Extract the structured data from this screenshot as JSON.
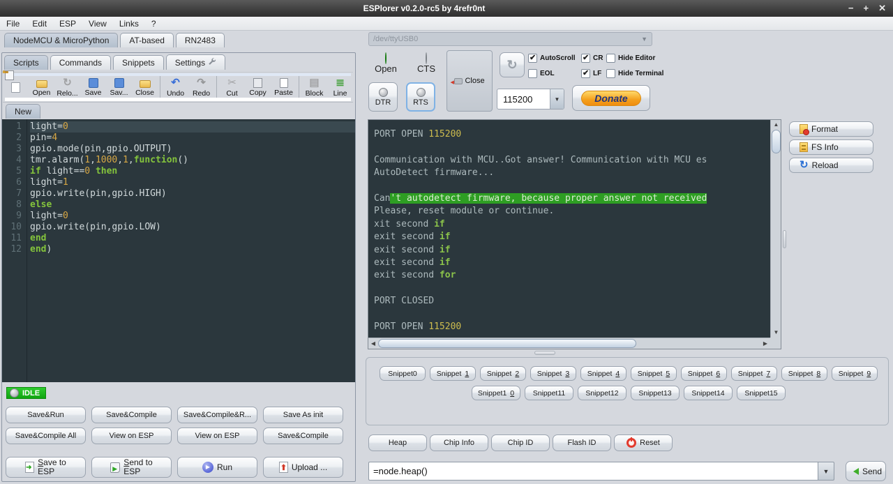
{
  "window": {
    "title": "ESPlorer v0.2.0-rc5 by 4refr0nt",
    "minimize": "−",
    "maximize": "+",
    "close": "✕"
  },
  "menu": {
    "items": [
      "File",
      "Edit",
      "ESP",
      "View",
      "Links",
      "?"
    ]
  },
  "left": {
    "device_tabs": [
      {
        "label": "NodeMCU & MicroPython",
        "selected": true
      },
      {
        "label": "AT-based",
        "selected": false
      },
      {
        "label": "RN2483",
        "selected": false
      }
    ],
    "tool_tabs": [
      {
        "label": "Scripts",
        "selected": true
      },
      {
        "label": "Commands",
        "selected": false
      },
      {
        "label": "Snippets",
        "selected": false
      },
      {
        "label": "Settings",
        "selected": false,
        "icon": "wrench-icon"
      }
    ],
    "toolbar": [
      {
        "label": "",
        "icon": "page",
        "name": "new-file",
        "gray": false
      },
      {
        "label": "Open",
        "icon": "folder",
        "name": "open",
        "gray": false
      },
      {
        "label": "Relo...",
        "icon": "reload-gray",
        "name": "reload",
        "gray": true
      },
      {
        "label": "Save",
        "icon": "floppy",
        "name": "save",
        "gray": false
      },
      {
        "label": "Sav...",
        "icon": "floppy",
        "name": "save-as",
        "gray": true
      },
      {
        "label": "Close",
        "icon": "folder",
        "name": "close-file",
        "gray": true
      },
      {
        "sep": true
      },
      {
        "label": "Undo",
        "icon": "undo",
        "name": "undo",
        "gray": false
      },
      {
        "label": "Redo",
        "icon": "redo",
        "name": "redo",
        "gray": true
      },
      {
        "sep": true
      },
      {
        "label": "Cut",
        "icon": "cut",
        "name": "cut",
        "gray": true
      },
      {
        "label": "Copy",
        "icon": "copy",
        "name": "copy",
        "gray": true
      },
      {
        "label": "Paste",
        "icon": "paste",
        "name": "paste",
        "gray": false
      },
      {
        "sep": true
      },
      {
        "label": "Block",
        "icon": "block",
        "name": "block-comment",
        "gray": true
      },
      {
        "label": "Line",
        "icon": "line",
        "name": "line-comment",
        "gray": false
      }
    ],
    "editor_tab": "New",
    "code_lines": [
      [
        {
          "t": "light=",
          "c": "p"
        },
        {
          "t": "0",
          "c": "n"
        }
      ],
      [
        {
          "t": "pin=",
          "c": "p"
        },
        {
          "t": "4",
          "c": "n"
        }
      ],
      [
        {
          "t": "gpio.mode(pin,gpio.OUTPUT)",
          "c": "p"
        }
      ],
      [
        {
          "t": "tmr.alarm(",
          "c": "p"
        },
        {
          "t": "1",
          "c": "n"
        },
        {
          "t": ",",
          "c": "p"
        },
        {
          "t": "1000",
          "c": "n"
        },
        {
          "t": ",",
          "c": "p"
        },
        {
          "t": "1",
          "c": "n"
        },
        {
          "t": ",",
          "c": "p"
        },
        {
          "t": "function",
          "c": "k"
        },
        {
          "t": "()",
          "c": "p"
        }
      ],
      [
        {
          "t": "if",
          "c": "k"
        },
        {
          "t": " light==",
          "c": "p"
        },
        {
          "t": "0",
          "c": "n"
        },
        {
          "t": " ",
          "c": "p"
        },
        {
          "t": "then",
          "c": "k"
        }
      ],
      [
        {
          "t": "light=",
          "c": "p"
        },
        {
          "t": "1",
          "c": "n"
        }
      ],
      [
        {
          "t": "gpio.write(pin,gpio.HIGH)",
          "c": "p"
        }
      ],
      [
        {
          "t": "else",
          "c": "k"
        }
      ],
      [
        {
          "t": "light=",
          "c": "p"
        },
        {
          "t": "0",
          "c": "n"
        }
      ],
      [
        {
          "t": "gpio.write(pin,gpio.LOW)",
          "c": "p"
        }
      ],
      [
        {
          "t": "end",
          "c": "k"
        }
      ],
      [
        {
          "t": "end",
          "c": "k"
        },
        {
          "t": ")",
          "c": "p"
        }
      ]
    ],
    "status": "IDLE",
    "action_row1": [
      "Save&Run",
      "Save&Compile",
      "Save&Compile&R...",
      "Save As init"
    ],
    "action_row2": [
      "Save&Compile All",
      "View on ESP",
      "View on ESP",
      "Save&Compile"
    ],
    "action_row3": [
      {
        "lines": [
          "Save to",
          "ESP"
        ],
        "icon": "savetoesp",
        "name": "save-to-esp",
        "underline_first": true
      },
      {
        "lines": [
          "Send to",
          "ESP"
        ],
        "icon": "sendtoesp",
        "name": "send-to-esp",
        "underline_first": true
      },
      {
        "lines": [
          "Run"
        ],
        "icon": "run",
        "name": "run",
        "underline_first": false
      },
      {
        "lines": [
          "Upload ..."
        ],
        "icon": "upload",
        "name": "upload",
        "underline_first": false
      }
    ]
  },
  "right": {
    "port": "/dev/ttyUSB0",
    "open_led_label": "Open",
    "cts_led_label": "CTS",
    "close_label": "Close",
    "checkbox_cols": [
      [
        {
          "label": "AutoScroll",
          "checked": true
        },
        {
          "label": "EOL",
          "checked": false
        }
      ],
      [
        {
          "label": "CR",
          "checked": true
        },
        {
          "label": "LF",
          "checked": true
        }
      ],
      [
        {
          "label": "Hide Editor",
          "checked": false
        },
        {
          "label": "Hide Terminal",
          "checked": false
        }
      ]
    ],
    "dtr_label": "DTR",
    "rts_label": "RTS",
    "baud": "115200",
    "donate_label": "Donate",
    "terminal_lines": [
      [
        {
          "t": "PORT OPEN ",
          "c": "t"
        },
        {
          "t": "115200",
          "c": "y"
        }
      ],
      [],
      [
        {
          "t": "Communication with MCU..Got answer! Communication with MCU es",
          "c": "t"
        }
      ],
      [
        {
          "t": "AutoDetect firmware...",
          "c": "t"
        }
      ],
      [],
      [
        {
          "t": "Can",
          "c": "t"
        },
        {
          "t": "'t autodetect firmware, because proper answer not received",
          "c": "hl"
        }
      ],
      [
        {
          "t": "Please, reset module or continue.",
          "c": "t"
        }
      ],
      [
        {
          "t": "xit second ",
          "c": "t"
        },
        {
          "t": "if",
          "c": "k"
        }
      ],
      [
        {
          "t": "exit second ",
          "c": "t"
        },
        {
          "t": "if",
          "c": "k"
        }
      ],
      [
        {
          "t": "exit second ",
          "c": "t"
        },
        {
          "t": "if",
          "c": "k"
        }
      ],
      [
        {
          "t": "exit second ",
          "c": "t"
        },
        {
          "t": "if",
          "c": "k"
        }
      ],
      [
        {
          "t": "exit second ",
          "c": "t"
        },
        {
          "t": "for",
          "c": "k"
        }
      ],
      [],
      [
        {
          "t": "PORT CLOSED",
          "c": "t"
        }
      ],
      [],
      [
        {
          "t": "PORT OPEN ",
          "c": "t"
        },
        {
          "t": "115200",
          "c": "y"
        }
      ]
    ],
    "fs_buttons": [
      {
        "label": "Format",
        "icon": "format",
        "name": "format"
      },
      {
        "label": "FS Info",
        "icon": "fsinfo",
        "name": "fs-info"
      },
      {
        "label": "Reload",
        "icon": "reload-blue",
        "name": "reload-fs"
      }
    ],
    "snippets_row1": [
      {
        "label": "Snippet0",
        "u": false
      },
      {
        "label": "Snippet1",
        "u": true
      },
      {
        "label": "Snippet2",
        "u": true
      },
      {
        "label": "Snippet3",
        "u": true
      },
      {
        "label": "Snippet4",
        "u": true
      },
      {
        "label": "Snippet5",
        "u": true
      },
      {
        "label": "Snippet6",
        "u": true
      },
      {
        "label": "Snippet7",
        "u": true
      },
      {
        "label": "Snippet8",
        "u": true
      },
      {
        "label": "Snippet9",
        "u": true
      }
    ],
    "snippets_row2": [
      {
        "label": "Snippet10",
        "u": true
      },
      {
        "label": "Snippet11",
        "u": false
      },
      {
        "label": "Snippet12",
        "u": false
      },
      {
        "label": "Snippet13",
        "u": false
      },
      {
        "label": "Snippet14",
        "u": false
      },
      {
        "label": "Snippet15",
        "u": false
      }
    ],
    "cmd_buttons": [
      {
        "label": "Heap",
        "icon": null,
        "name": "heap"
      },
      {
        "label": "Chip Info",
        "icon": null,
        "name": "chip-info"
      },
      {
        "label": "Chip ID",
        "icon": null,
        "name": "chip-id"
      },
      {
        "label": "Flash ID",
        "icon": null,
        "name": "flash-id"
      },
      {
        "label": "Reset",
        "icon": "power",
        "name": "reset"
      }
    ],
    "command_value": "=node.heap()",
    "send_label": "Send"
  },
  "colors": {
    "terminal_bg": "#2b373d",
    "highlight_green": "#2e9e23",
    "keyword_green": "#8bc34a",
    "number_yellow": "#cdbc4e",
    "status_green": "#10a410",
    "donate_orange": "#f4a01d"
  }
}
